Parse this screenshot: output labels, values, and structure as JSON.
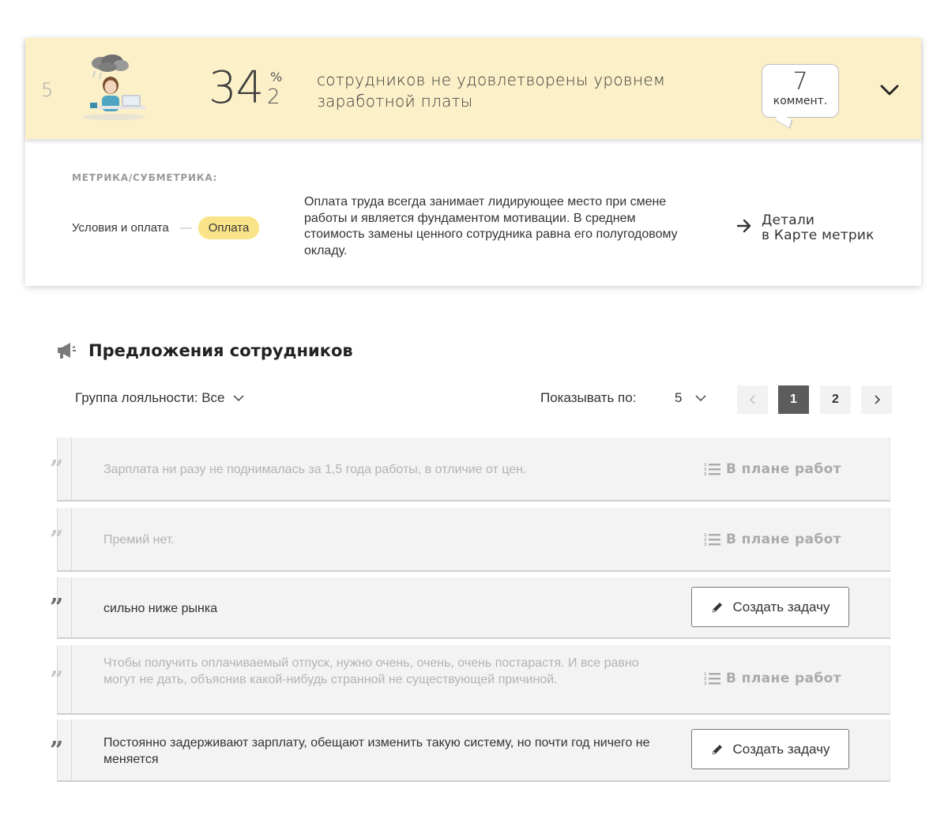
{
  "metric": {
    "rank": "5",
    "value_int": "34",
    "value_dec": "2",
    "value_unit": "%",
    "headline": "сотрудников не удовлетворены уровнем заработной платы",
    "comments_count": "7",
    "comments_label": "коммент.",
    "caption": "МЕТРИКА/СУБМЕТРИКА:",
    "category": "Условия и оплата",
    "category_separator": "—",
    "submetric": "Оплата",
    "description": "Оплата труда всегда занимает лидирующее место при смене работы и является фундаментом мотивации. В среднем стоимость замены ценного сотрудника равна его полугодовому окладу.",
    "details_line1": "Детали",
    "details_line2": "в Карте метрик"
  },
  "section": {
    "title": "Предложения сотрудников",
    "filter_label": "Группа лояльности: Все",
    "page_size_label": "Показывать по:",
    "page_size_value": "5"
  },
  "pagination": {
    "prev_label": "‹",
    "pages": [
      "1",
      "2"
    ],
    "current_page": "1",
    "next_label": "›"
  },
  "suggestions": [
    {
      "text": "Зарплата ни разу не поднималась за 1,5 года работы, в отличие от цен.",
      "status": "В плане работ"
    },
    {
      "text": "Премий нет.",
      "status": "В плане работ"
    },
    {
      "text": "сильно ниже рынка",
      "action": "Создать задачу"
    },
    {
      "text": "Чтобы получить оплачиваемый отпуск, нужно очень, очень, очень постарастя. И все равно могут не дать, объяснив какой-нибудь странной не существующей причиной.",
      "status": "В плане работ"
    },
    {
      "text": "Постоянно задерживают зарплату, обещают изменить такую систему, но почти год ничего не меняется",
      "action": "Создать задачу"
    }
  ],
  "quote_glyph": "”",
  "icons": {
    "expand": "chevron-down-icon",
    "details": "arrow-right-icon",
    "section": "megaphone-icon",
    "plan": "numbered-list-icon",
    "create": "pencil-icon",
    "quote": "quote-icon"
  },
  "colors": {
    "header_bg": "#fcf0c8",
    "pill_bg": "#fae48a",
    "active_page_bg": "#5c5c5c",
    "muted_text": "#b3b3b3",
    "card_bg": "#f3f3f3"
  }
}
